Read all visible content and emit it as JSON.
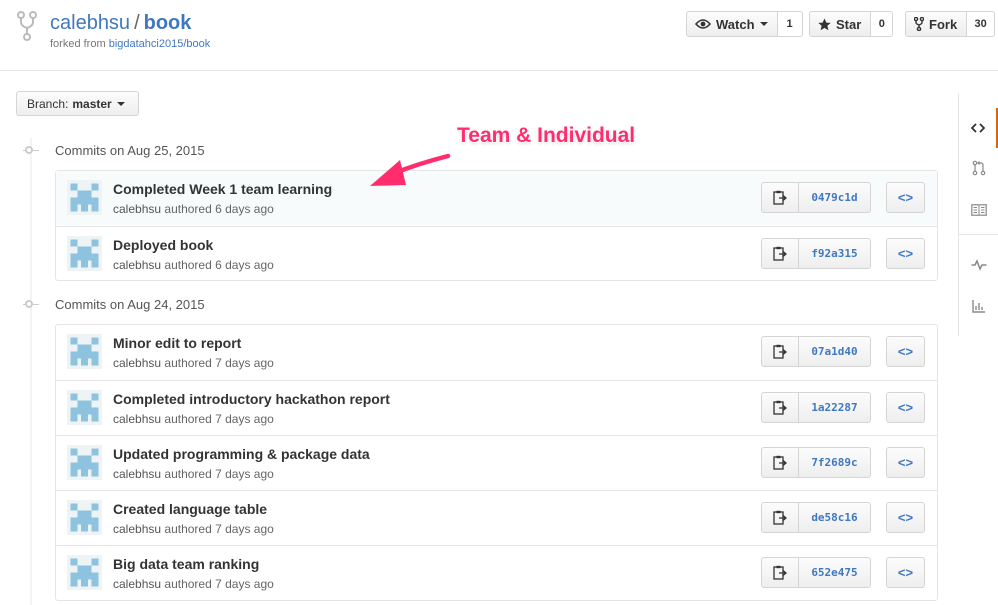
{
  "repo": {
    "owner": "calebhsu",
    "separator": "/",
    "name": "book",
    "forked_prefix": "forked from",
    "forked_source": "bigdatahci2015/book"
  },
  "actions": {
    "watch_label": "Watch",
    "watch_count": "1",
    "star_label": "Star",
    "star_count": "0",
    "fork_label": "Fork",
    "fork_count": "30"
  },
  "branch": {
    "prefix": "Branch:",
    "name": "master"
  },
  "annotation": {
    "text": "Team & Individual",
    "color": "#ff2d6e"
  },
  "accent": "#4078c0",
  "groups": [
    {
      "heading": "Commits on Aug 25, 2015",
      "commits": [
        {
          "title": "Completed Week 1 team learning",
          "author": "calebhsu",
          "verb": "authored",
          "when": "6 days ago",
          "sha": "0479c1d",
          "highlighted": true
        },
        {
          "title": "Deployed book",
          "author": "calebhsu",
          "verb": "authored",
          "when": "6 days ago",
          "sha": "f92a315",
          "highlighted": false
        }
      ]
    },
    {
      "heading": "Commits on Aug 24, 2015",
      "commits": [
        {
          "title": "Minor edit to report",
          "author": "calebhsu",
          "verb": "authored",
          "when": "7 days ago",
          "sha": "07a1d40",
          "highlighted": false
        },
        {
          "title": "Completed introductory hackathon report",
          "author": "calebhsu",
          "verb": "authored",
          "when": "7 days ago",
          "sha": "1a22287",
          "highlighted": false
        },
        {
          "title": "Updated programming & package data",
          "author": "calebhsu",
          "verb": "authored",
          "when": "7 days ago",
          "sha": "7f2689c",
          "highlighted": false
        },
        {
          "title": "Created language table",
          "author": "calebhsu",
          "verb": "authored",
          "when": "7 days ago",
          "sha": "de58c16",
          "highlighted": false
        },
        {
          "title": "Big data team ranking",
          "author": "calebhsu",
          "verb": "authored",
          "when": "7 days ago",
          "sha": "652e475",
          "highlighted": false
        }
      ]
    }
  ],
  "browse_glyph": "<>",
  "sidebar": [
    "code-icon",
    "pull-request-icon",
    "wiki-icon",
    "pulse-icon",
    "graph-icon"
  ]
}
